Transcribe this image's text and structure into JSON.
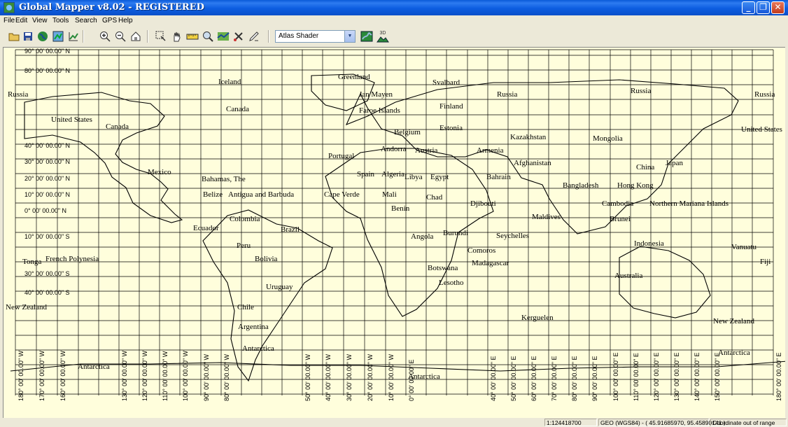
{
  "window": {
    "title": "Global Mapper v8.02 - REGISTERED"
  },
  "menu": [
    "File",
    "Edit",
    "View",
    "Tools",
    "Search",
    "GPS",
    "Help"
  ],
  "toolbar": {
    "buttons": [
      "open-icon",
      "save-icon",
      "globe-icon",
      "digitizer-icon",
      "chart-icon",
      "zoom-in-icon",
      "zoom-out-icon",
      "home-icon",
      "select-icon",
      "pan-icon",
      "measure-icon",
      "info-icon",
      "path-profile-icon",
      "tools-icon",
      "edit-icon"
    ],
    "shader_value": "Atlas Shader",
    "shader_label_3d": "3D"
  },
  "map": {
    "background": "#fffedc",
    "lat_labels": [
      "90° 00' 00.00\" N",
      "80° 00' 00.00\" N",
      "40° 00' 00.00\" N",
      "30° 00' 00.00\" N",
      "20° 00' 00.00\" N",
      "10° 00' 00.00\" N",
      "0° 00' 00.00\" N",
      "10° 00' 00.00\" S",
      "30° 00' 00.00\" S",
      "40° 00' 00.00\" S"
    ],
    "lon_labels": [
      "180° 00' 00.00\" W",
      "170° 00' 00.00\" W",
      "160° 00' 00.00\" W",
      "130° 00' 00.00\" W",
      "120° 00' 00.00\" W",
      "110° 00' 00.00\" W",
      "100° 00' 00.00\" W",
      "90° 00' 00.00\" W",
      "80° 00' 00.00\" W",
      "50° 00' 00.00\" W",
      "40° 00' 00.00\" W",
      "30° 00' 00.00\" W",
      "20° 00' 00.00\" W",
      "10° 00' 00.00\" W",
      "0° 00' 00.00\" E",
      "40° 00' 00.00\" E",
      "50° 00' 00.00\" E",
      "60° 00' 00.00\" E",
      "70° 00' 00.00\" E",
      "80° 00' 00.00\" E",
      "90° 00' 00.00\" E",
      "100° 00' 00.00\" E",
      "110° 00' 00.00\" E",
      "120° 00' 00.00\" E",
      "130° 00' 00.00\" E",
      "140° 00' 00.00\" E",
      "150° 00' 00.00\" E",
      "180° 00' 00.00\" E"
    ],
    "places": [
      "Russia",
      "Greenland",
      "Svalbard",
      "Iceland",
      "Jan Mayen",
      "Russia",
      "Russia",
      "Russia",
      "Canada",
      "Faroe Islands",
      "Finland",
      "United States",
      "Canada",
      "Belgium",
      "Estonia",
      "United States",
      "Kazakhstan",
      "Mongolia",
      "Andorra",
      "Austria",
      "Armenia",
      "Portugal",
      "Afghanistan",
      "Japan",
      "China",
      "Mexico",
      "Spain",
      "Algeria",
      "Libya",
      "Egypt",
      "Bahrain",
      "Bahamas, The",
      "Bangladesh",
      "Hong Kong",
      "Belize",
      "Antigua and Barbuda",
      "Cape Verde",
      "Mali",
      "Chad",
      "Djibouti",
      "Cambodia",
      "Northern Mariana Islands",
      "Benin",
      "Maldives",
      "Colombia",
      "Ecuador",
      "Brazil",
      "Brunei",
      "Burundi",
      "Seychelles",
      "Angola",
      "Indonesia",
      "Peru",
      "Comoros",
      "Vanuatu",
      "Tonga",
      "French Polynesia",
      "Bolivia",
      "Madagascar",
      "Fiji",
      "Botswana",
      "Australia",
      "Lesotho",
      "Uruguay",
      "New Zealand",
      "Chile",
      "Kerguelen",
      "New Zealand",
      "Argentina",
      "Antarctica",
      "Antarctica",
      "Antarctica",
      "Antarctica"
    ]
  },
  "status": {
    "scale": "1:124418700",
    "projection": "GEO (WGS84) - ( 45.91685970, 95.45890141 )",
    "message": "Coordinate out of range"
  }
}
